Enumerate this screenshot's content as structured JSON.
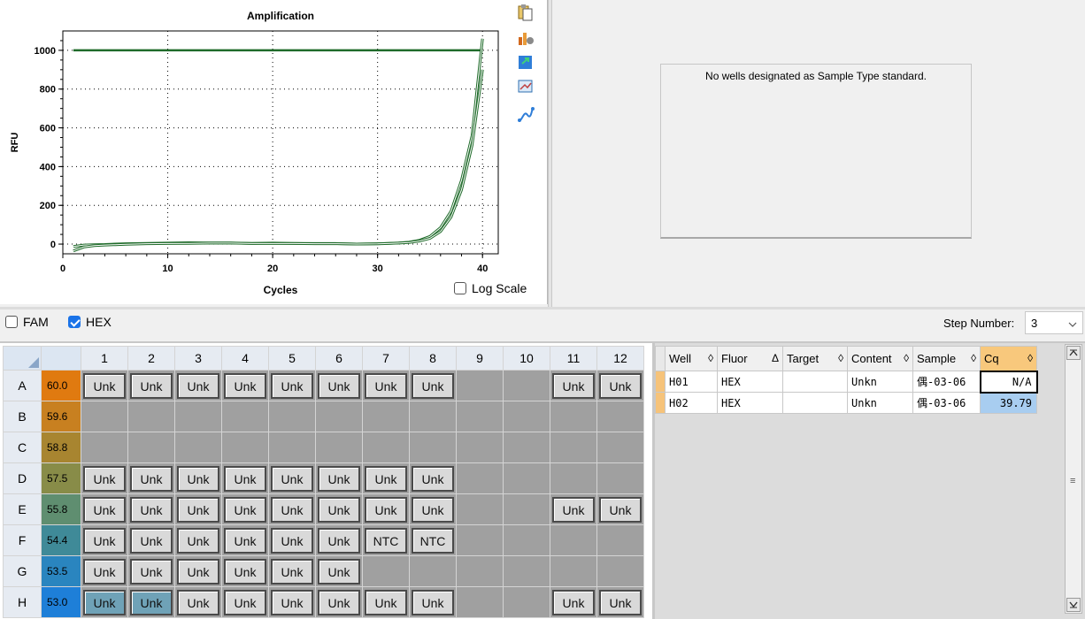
{
  "chart_data": {
    "type": "line",
    "title": "Amplification",
    "xlabel": "Cycles",
    "ylabel": "RFU",
    "xlim": [
      0,
      41.5
    ],
    "ylim": [
      -50,
      1100
    ],
    "xticks": [
      0,
      10,
      20,
      30,
      40
    ],
    "yticks": [
      0,
      200,
      400,
      600,
      800,
      1000
    ],
    "grid": "dotted",
    "threshold": {
      "y": 1000,
      "x": [
        1,
        40
      ]
    },
    "series": [
      {
        "x": [
          1,
          2,
          3,
          4,
          5,
          6,
          8,
          10,
          12,
          14,
          16,
          18,
          20,
          22,
          24,
          26,
          28,
          30,
          31,
          32,
          33,
          34,
          35,
          36,
          37,
          38,
          39,
          40
        ],
        "y": [
          -12,
          -5,
          -3,
          -2,
          0,
          2,
          4,
          5,
          7,
          6,
          6,
          4,
          5,
          4,
          3,
          3,
          0,
          2,
          4,
          6,
          10,
          20,
          40,
          85,
          170,
          330,
          560,
          1060
        ]
      },
      {
        "x": [
          1,
          2,
          3,
          4,
          5,
          6,
          8,
          10,
          12,
          14,
          16,
          18,
          20,
          22,
          24,
          26,
          28,
          30,
          31,
          32,
          33,
          34,
          35,
          36,
          37,
          38,
          39,
          40
        ],
        "y": [
          -35,
          -15,
          -8,
          -5,
          -3,
          -1,
          2,
          3,
          4,
          5,
          5,
          3,
          3,
          3,
          2,
          2,
          0,
          1,
          3,
          5,
          8,
          16,
          30,
          65,
          140,
          280,
          510,
          900
        ]
      }
    ]
  },
  "chart_controls": {
    "log_scale_label": "Log Scale",
    "log_scale_checked": false,
    "tool_icons": [
      "copy-icon",
      "chart-settings-icon",
      "export-icon",
      "zoom-icon",
      "curve-icon"
    ]
  },
  "standard_panel": {
    "message": "No wells designated as Sample Type standard."
  },
  "fluors": [
    {
      "label": "FAM",
      "checked": false
    },
    {
      "label": "HEX",
      "checked": true
    }
  ],
  "step": {
    "label": "Step Number:",
    "value": "3"
  },
  "plate": {
    "columns": [
      "1",
      "2",
      "3",
      "4",
      "5",
      "6",
      "7",
      "8",
      "9",
      "10",
      "11",
      "12"
    ],
    "rows": [
      {
        "label": "A",
        "temp": "60.0",
        "color": "#e07a10",
        "wells": [
          "Unk",
          "Unk",
          "Unk",
          "Unk",
          "Unk",
          "Unk",
          "Unk",
          "Unk",
          "",
          "",
          "Unk",
          "Unk"
        ]
      },
      {
        "label": "B",
        "temp": "59.6",
        "color": "#c88020",
        "wells": [
          "",
          "",
          "",
          "",
          "",
          "",
          "",
          "",
          "",
          "",
          "",
          ""
        ]
      },
      {
        "label": "C",
        "temp": "58.8",
        "color": "#a88530",
        "wells": [
          "",
          "",
          "",
          "",
          "",
          "",
          "",
          "",
          "",
          "",
          "",
          ""
        ]
      },
      {
        "label": "D",
        "temp": "57.5",
        "color": "#888c48",
        "wells": [
          "Unk",
          "Unk",
          "Unk",
          "Unk",
          "Unk",
          "Unk",
          "Unk",
          "Unk",
          "",
          "",
          "",
          ""
        ]
      },
      {
        "label": "E",
        "temp": "55.8",
        "color": "#5f8e70",
        "wells": [
          "Unk",
          "Unk",
          "Unk",
          "Unk",
          "Unk",
          "Unk",
          "Unk",
          "Unk",
          "",
          "",
          "Unk",
          "Unk"
        ]
      },
      {
        "label": "F",
        "temp": "54.4",
        "color": "#3f8a98",
        "wells": [
          "Unk",
          "Unk",
          "Unk",
          "Unk",
          "Unk",
          "Unk",
          "NTC",
          "NTC",
          "",
          "",
          "",
          ""
        ]
      },
      {
        "label": "G",
        "temp": "53.5",
        "color": "#2a85bf",
        "wells": [
          "Unk",
          "Unk",
          "Unk",
          "Unk",
          "Unk",
          "Unk",
          "",
          "",
          "",
          "",
          "",
          ""
        ]
      },
      {
        "label": "H",
        "temp": "53.0",
        "color": "#1e7fd8",
        "wells": [
          "Unk",
          "Unk",
          "Unk",
          "Unk",
          "Unk",
          "Unk",
          "Unk",
          "Unk",
          "",
          "",
          "Unk",
          "Unk"
        ]
      }
    ],
    "selected_wells": [
      "H1",
      "H2"
    ]
  },
  "results": {
    "headers": [
      "Well",
      "Fluor",
      "Target",
      "Content",
      "Sample",
      "Cq"
    ],
    "sort_icons": [
      "◊",
      "Δ",
      "◊",
      "◊",
      "◊",
      "◊"
    ],
    "rows": [
      [
        "H01",
        "HEX",
        "",
        "Unkn",
        "偶-03-06",
        "N/A"
      ],
      [
        "H02",
        "HEX",
        "",
        "Unkn",
        "偶-03-06",
        "39.79"
      ]
    ]
  }
}
